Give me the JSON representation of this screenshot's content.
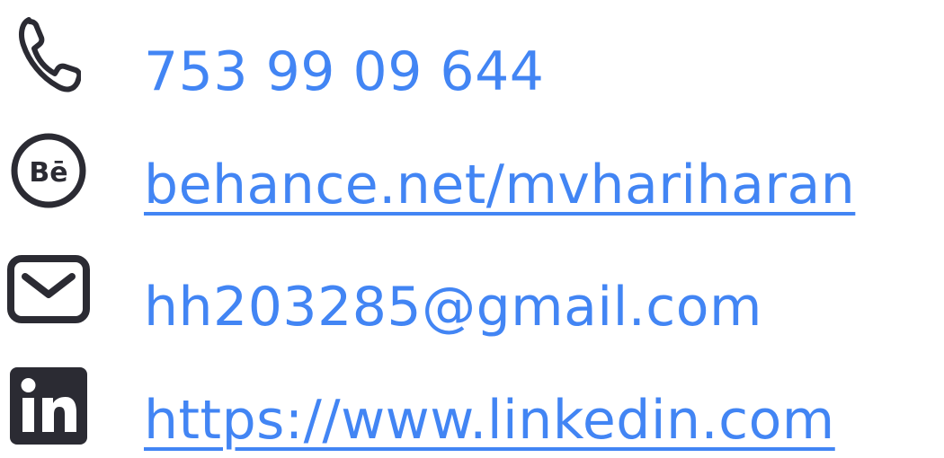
{
  "colors": {
    "text": "#4285f4",
    "icon": "#2b2b33"
  },
  "contacts": {
    "phone": {
      "icon": "phone-icon",
      "text": "753 99 09 644"
    },
    "behance": {
      "icon": "behance-icon",
      "text": "behance.net/mvhariharan"
    },
    "email": {
      "icon": "mail-icon",
      "text": "hh203285@gmail.com"
    },
    "linkedin": {
      "icon": "linkedin-icon",
      "text": "https://www.linkedin.com"
    }
  }
}
